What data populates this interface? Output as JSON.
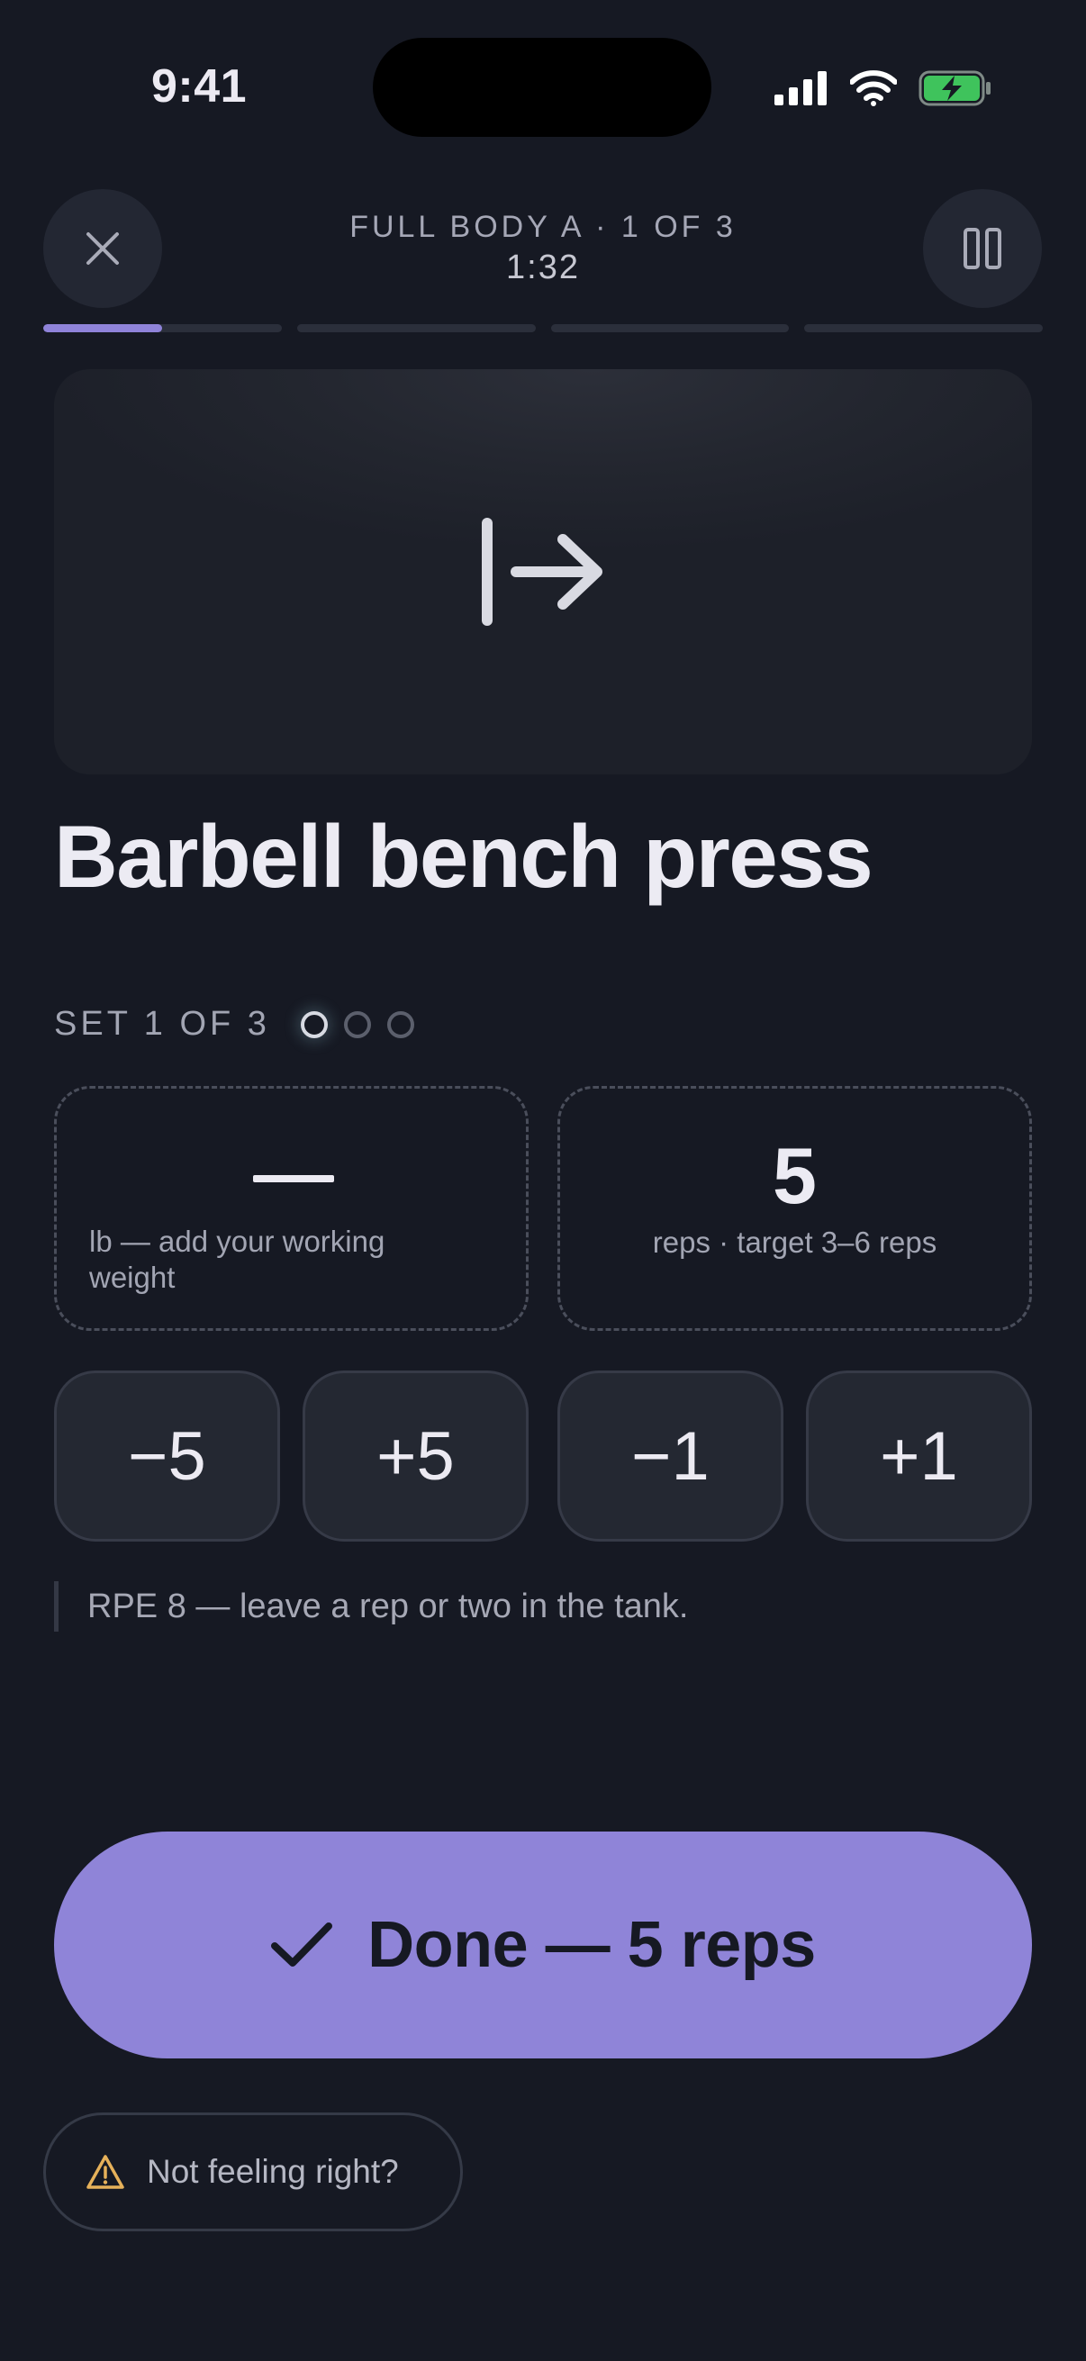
{
  "status_bar": {
    "time": "9:41"
  },
  "header": {
    "workout_title": "FULL BODY A · 1 OF 3",
    "timer": "1:32",
    "progress_segments": [
      0.5,
      0,
      0,
      0
    ]
  },
  "exercise": {
    "name": "Barbell bench press",
    "hero_icon": "arrow-right-to-line-icon"
  },
  "set": {
    "label": "SET 1 OF 3",
    "total": 3,
    "current": 1
  },
  "weight": {
    "value": "—",
    "caption": "lb — add your working weight"
  },
  "reps": {
    "value": "5",
    "caption": "reps · target 3–6 reps"
  },
  "steppers": [
    "−5",
    "+5",
    "−1",
    "+1"
  ],
  "tip": "RPE 8 — leave a rep or two in the tank.",
  "done_button": {
    "label": "Done — 5 reps"
  },
  "help_button": {
    "label": "Not feeling right?"
  },
  "colors": {
    "background": "#161923",
    "accent": "#8f84d8",
    "battery": "#3fc35c",
    "warning": "#e6b15a"
  }
}
